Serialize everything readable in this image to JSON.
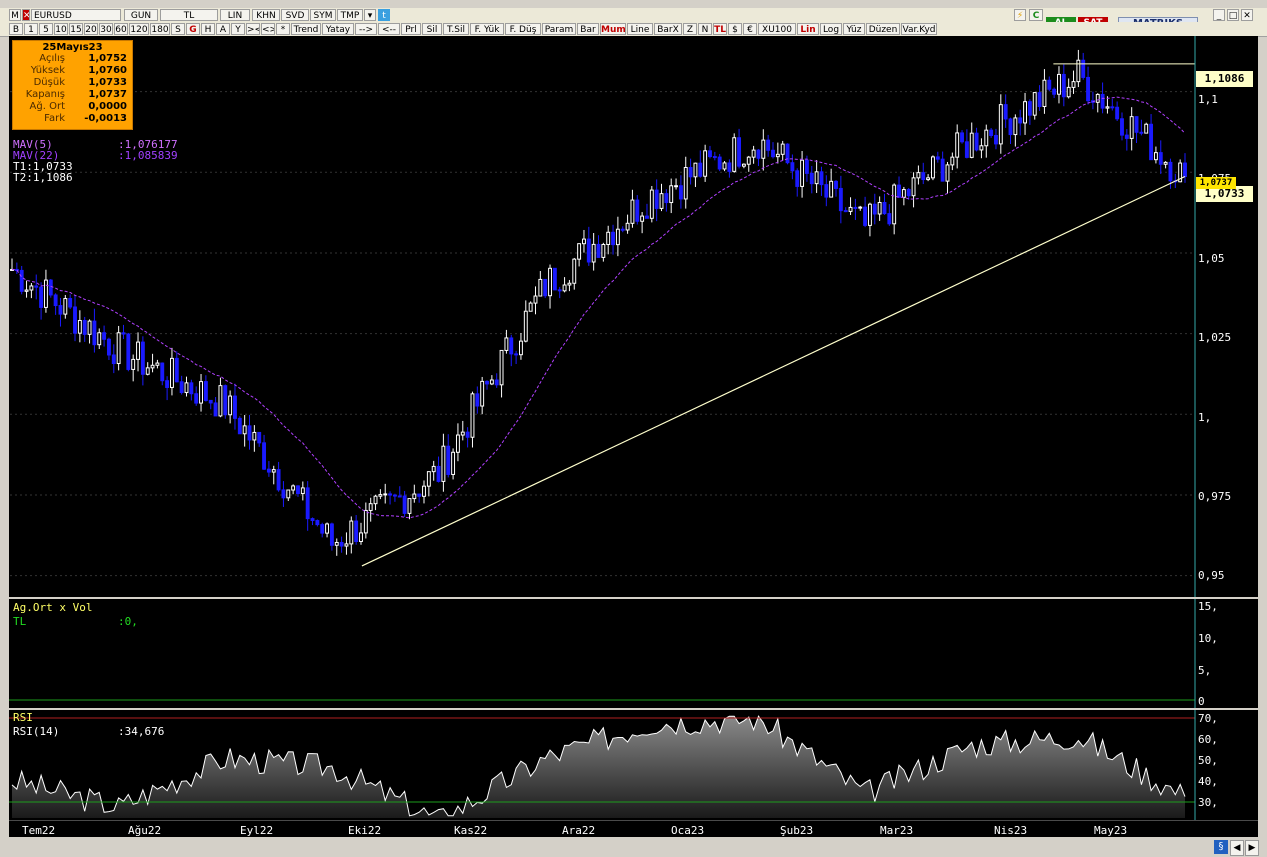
{
  "toolbar1": {
    "symbol_menu": "M",
    "symbol": "EURUSD",
    "period": "GUN",
    "currency": "TL",
    "scale": "LIN",
    "buttons": [
      "KHN",
      "SVD",
      "SYM",
      "TMP"
    ],
    "buy": "AL",
    "sell": "SAT",
    "brand": "MATRIKS"
  },
  "toolbar2": {
    "items": [
      "B",
      "1",
      "5",
      "10",
      "15",
      "20",
      "30",
      "60",
      "120",
      "180",
      "S",
      "G",
      "H",
      "A",
      "Y",
      "><",
      "<>",
      "*",
      "Trend",
      "Yatay",
      "-->",
      "<--",
      "Prl",
      "Sil",
      "T.Sil",
      "F. Yük",
      "F. Düş",
      "Param",
      "Bar",
      "Mum",
      "Line",
      "BarX",
      "Z",
      "N",
      "TL",
      "$",
      "€",
      "XU100",
      "Lin",
      "Log",
      "Yüz",
      "Düzen",
      "Var.Kyd"
    ]
  },
  "info": {
    "date": "25Mayıs23",
    "rows": [
      {
        "label": "Açılış",
        "value": "1,0752"
      },
      {
        "label": "Yüksek",
        "value": "1,0760"
      },
      {
        "label": "Düşük",
        "value": "1,0733"
      },
      {
        "label": "Kapanış",
        "value": "1,0737"
      },
      {
        "label": "Ağ. Ort",
        "value": "0,0000"
      },
      {
        "label": "Fark",
        "value": "-0,0013"
      }
    ]
  },
  "legend": {
    "mav5_label": "MAV(5)",
    "mav5_value": ":1,076177",
    "mav22_label": "MAV(22)",
    "mav22_value": ":1,085839",
    "t1": "T1:1,0733",
    "t2": "T2:1,1086"
  },
  "vol_panel": {
    "title": "Ag.Ort x Vol",
    "series_label": "TL",
    "series_value": ":0,"
  },
  "rsi_panel": {
    "title": "RSI",
    "series_label": "RSI(14)",
    "series_value": ":34,676"
  },
  "colors": {
    "up": "#ffffff",
    "down": "#1a1aff",
    "mav5": "#ffffff",
    "mav22": "#b040ff",
    "trend": "#ffffcc",
    "rsi": "#ffffff"
  },
  "chart_data": [
    {
      "type": "candlestick",
      "price_labels": [
        "1,1086",
        "1,0737",
        "1,0733"
      ],
      "y_ticks": [
        "1,1",
        "1,075",
        "1,05",
        "1,025",
        "1,",
        "0,975",
        "0,95"
      ],
      "ylim": [
        0.944,
        1.116
      ],
      "x_ticks": [
        "Tem22",
        "Ağu22",
        "Eyl22",
        "Eki22",
        "Kas22",
        "Ara22",
        "Oca23",
        "Şub23",
        "Mar23",
        "Nis23",
        "May23"
      ],
      "x": [
        "Tem22",
        "Ağu22",
        "Eyl22",
        "Eki22",
        "Kas22",
        "Ara22",
        "Oca23",
        "Şub23",
        "Mar23",
        "Nis23",
        "May23",
        "25May23"
      ],
      "close": [
        1.045,
        1.02,
        1.003,
        0.96,
        0.982,
        1.04,
        1.068,
        1.085,
        1.058,
        1.085,
        1.105,
        1.0737
      ],
      "annotations": [
        {
          "type": "trendline",
          "from": [
            "Eki22",
            0.953
          ],
          "to": [
            "25May23",
            1.0737
          ]
        },
        {
          "type": "level",
          "label": "T2",
          "value": 1.1086
        },
        {
          "type": "level",
          "label": "T1",
          "value": 1.0733
        }
      ]
    },
    {
      "type": "area",
      "series": [
        {
          "name": "TL",
          "values": [
            0
          ]
        }
      ],
      "y_ticks": [
        "15,",
        "10,",
        "5,",
        "0"
      ],
      "ylim": [
        0,
        15
      ]
    },
    {
      "type": "line",
      "series": [
        {
          "name": "RSI(14)",
          "values": [
            42,
            30,
            52,
            48,
            24,
            52,
            68,
            70,
            36,
            58,
            62,
            34.676
          ]
        }
      ],
      "x": [
        "Tem22",
        "Ağu22",
        "Eyl22",
        "Eki22",
        "Kas22",
        "Ara22",
        "Oca23",
        "Şub23",
        "Mar23",
        "Nis23",
        "May23",
        "25May23"
      ],
      "y_ticks": [
        "70,",
        "60,",
        "50,",
        "40,",
        "30,"
      ],
      "ylim": [
        25,
        72
      ],
      "levels": [
        30,
        70
      ]
    }
  ]
}
